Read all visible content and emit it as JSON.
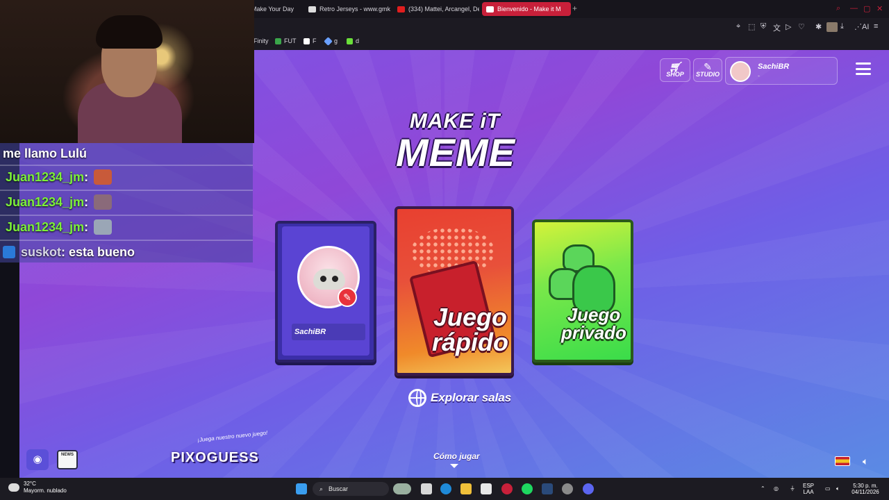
{
  "browser": {
    "tabs": [
      {
        "title": "Make Your Day",
        "active": false
      },
      {
        "title": "Retro Jerseys - www.gmk",
        "active": false
      },
      {
        "title": "(334) Mattei, Arcangel, De",
        "active": false
      },
      {
        "title": "Bienvenido - Make it M",
        "active": true
      }
    ],
    "new_tab": "+",
    "bookmarks": [
      "Finity",
      "FUT",
      "F",
      "g",
      "d"
    ],
    "toolbar_ai": "AI"
  },
  "game": {
    "shop_label": "SHOP",
    "studio_label": "STUDIO",
    "username": "SachiBR",
    "username_sub": "-",
    "logo_line1": "MAKE iT",
    "logo_line2": "MEME",
    "profile_card_name": "SachiBR",
    "quick_play_line1": "Juego",
    "quick_play_line2": "rápido",
    "private_line1": "Juego",
    "private_line2": "privado",
    "explore_label": "Explorar salas",
    "howto_label": "Cómo jugar",
    "pixo_tagline": "¡Juega nuestro nuevo juego!",
    "pixo_label": "PIXOGUESS",
    "news_label": "NEWS",
    "colors": {
      "accent_red": "#e8323c",
      "purple": "#7a55e6",
      "green": "#3adc4a"
    }
  },
  "chat": {
    "messages": [
      {
        "user": "",
        "text": "me llamo Lulú",
        "emote": false
      },
      {
        "user": "Juan1234_jm",
        "text": " : ",
        "emote": true
      },
      {
        "user": "Juan1234_jm",
        "text": " : ",
        "emote": true
      },
      {
        "user": "Juan1234_jm",
        "text": " : ",
        "emote": true
      },
      {
        "user": "suskot",
        "text": " : esta bueno",
        "emote": false
      }
    ]
  },
  "taskbar": {
    "temperature": "32°C",
    "weather": "Mayorm. nublado",
    "search_placeholder": "Buscar",
    "lang": "ESP",
    "lang_sub": "LAA",
    "time": "5:30 p. m.",
    "date": "04/11/2026"
  }
}
